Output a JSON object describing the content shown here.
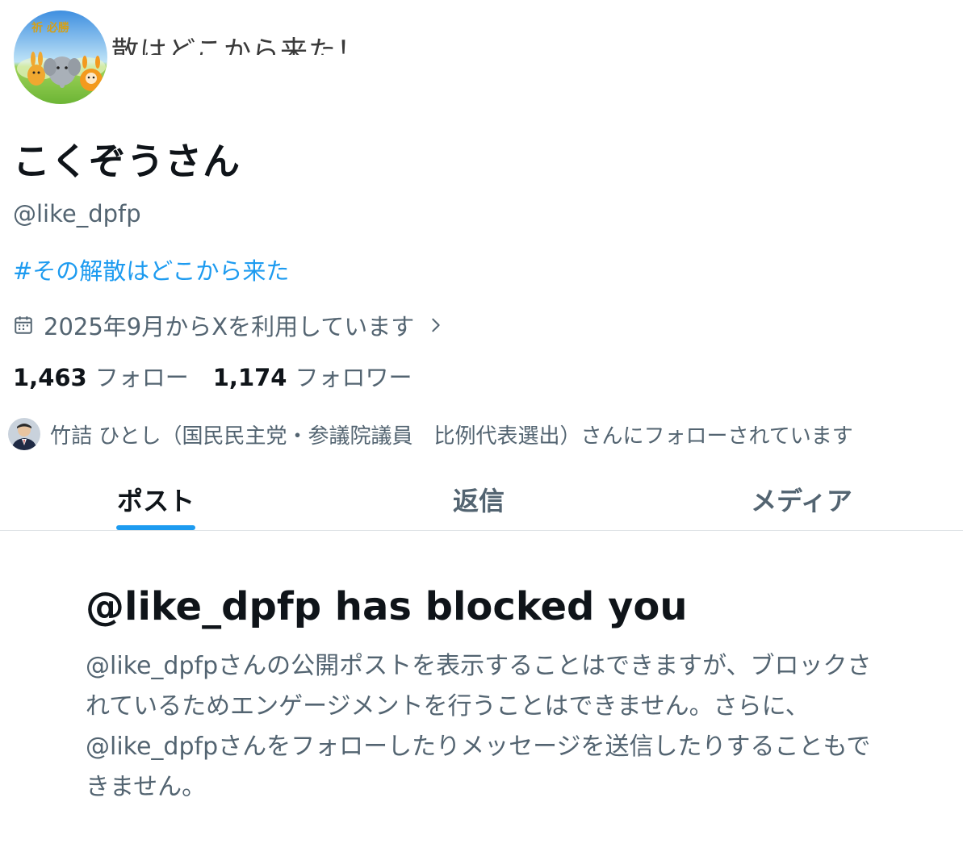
{
  "banner": {
    "partial_text": "散はどこから来た！"
  },
  "profile": {
    "avatar_text": "祈 必勝",
    "display_name": "こくぞうさん",
    "handle": "@like_dpfp",
    "bio_hashtag": "#その解散はどこから来た",
    "joined": "2025年9月からXを利用しています",
    "following_count": "1,463",
    "following_label": "フォロー",
    "followers_count": "1,174",
    "followers_label": "フォロワー",
    "followed_by": "竹詰 ひとし（国民民主党・参議院議員　比例代表選出）さんにフォローされています"
  },
  "icons": {
    "calendar": "calendar-icon",
    "chevron": "chevron-right-icon"
  },
  "tabs": [
    {
      "label": "ポスト",
      "active": true
    },
    {
      "label": "返信",
      "active": false
    },
    {
      "label": "メディア",
      "active": false
    }
  ],
  "blocked": {
    "title": "@like_dpfp has blocked you",
    "message": "@like_dpfpさんの公開ポストを表示することはできますが、ブロックされているためエンゲージメントを行うことはできません。さらに、@like_dpfpさんをフォローしたりメッセージを送信したりすることもできません。"
  },
  "colors": {
    "accent": "#1d9bf0",
    "text_primary": "#0f1419",
    "text_secondary": "#536471"
  }
}
